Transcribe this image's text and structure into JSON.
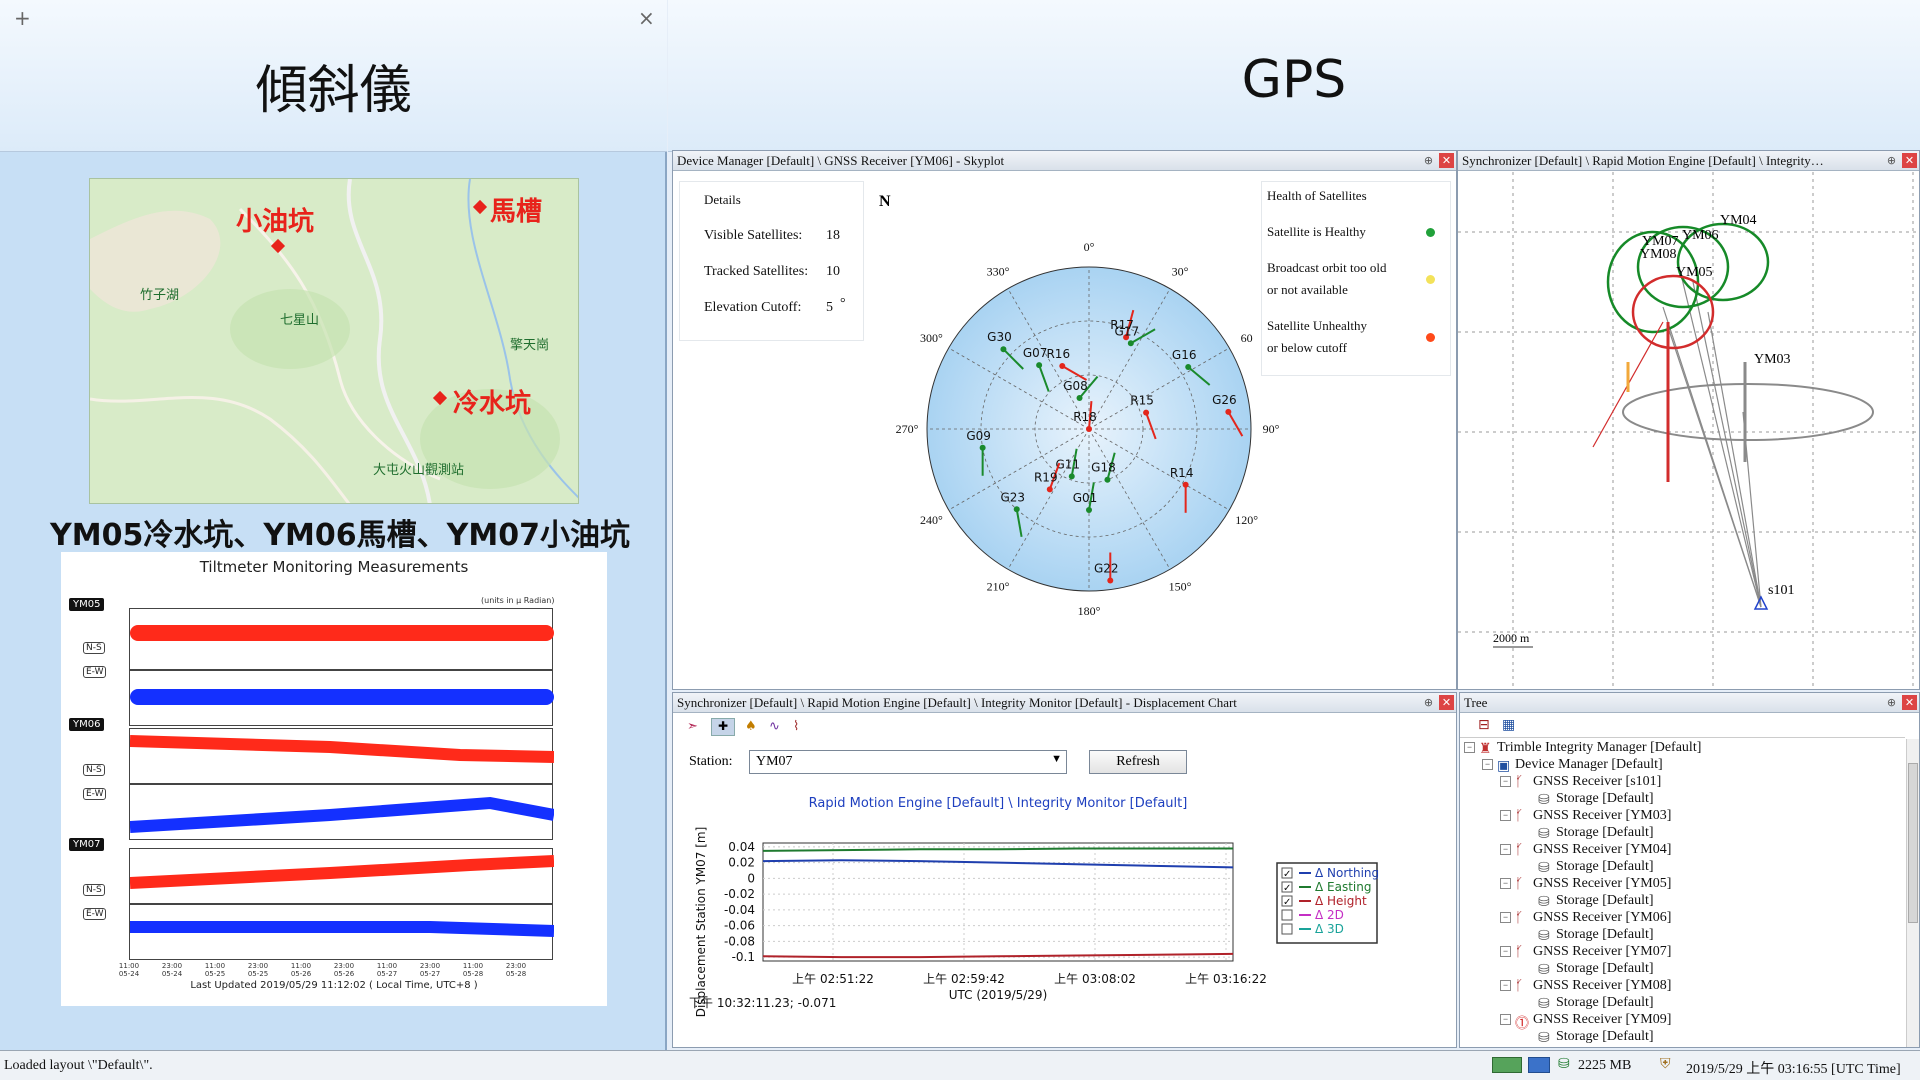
{
  "left": {
    "title": "傾斜儀",
    "new_tab": "+",
    "close": "×",
    "map": {
      "labels_big": [
        "小油坑",
        "馬槽",
        "冷水坑"
      ],
      "labels_small": [
        "竹子湖",
        "七星山",
        "擎天崗",
        "大屯火山觀測站"
      ]
    },
    "stations_caption": "YM05冷水坑、YM06馬槽、YM07小油坑",
    "tiltmeter": {
      "title": "Tiltmeter Monitoring Measurements",
      "units": "(units in μ Radian)",
      "stations": [
        "YM05",
        "YM06",
        "YM07"
      ],
      "axis_ns": "N-S",
      "axis_ew": "E-W",
      "dates": [
        "11:00\n05-24",
        "23:00\n05-24",
        "11:00\n05-25",
        "23:00\n05-25",
        "11:00\n05-26",
        "23:00\n05-26",
        "11:00\n05-27",
        "23:00\n05-27",
        "11:00\n05-28",
        "23:00\n05-28"
      ],
      "updated": "Last Updated 2019/05/29 11:12:02 ( Local Time, UTC+8 )",
      "colors": {
        "ns": "#ff2a1a",
        "ew": "#1430ff"
      }
    }
  },
  "gps": {
    "title": "GPS",
    "skyplot": {
      "title": "Device Manager [Default] \\ GNSS Receiver [YM06] - Skyplot",
      "details_label": "Details",
      "visible_label": "Visible Satellites:",
      "visible_value": "18",
      "tracked_label": "Tracked Satellites:",
      "tracked_value": "10",
      "cutoff_label": "Elevation Cutoff:",
      "cutoff_value": "5",
      "cutoff_unit": "°",
      "health_label": "Health of Satellites",
      "healthy": "Satellite is Healthy",
      "broadcast_1": "Broadcast orbit too old",
      "broadcast_2": "or not available",
      "unhealthy_1": "Satellite Unhealthy",
      "unhealthy_2": "or below cutoff",
      "north_symbol": "N",
      "azimuths": [
        "0°",
        "30°",
        "60",
        "90°",
        "120°",
        "150°",
        "180°",
        "210°",
        "240°",
        "270°",
        "300°",
        "330°"
      ],
      "satellites": [
        {
          "id": "G30",
          "az": 313,
          "el": 25,
          "color": "green",
          "dir": 135
        },
        {
          "id": "R16",
          "az": 337,
          "el": 52,
          "color": "red",
          "dir": 120
        },
        {
          "id": "R17",
          "az": 22,
          "el": 35,
          "color": "red",
          "dir": 15
        },
        {
          "id": "G17",
          "az": 26,
          "el": 37,
          "color": "green",
          "dir": 60
        },
        {
          "id": "G07",
          "az": 322,
          "el": 45,
          "color": "green",
          "dir": 160
        },
        {
          "id": "G08",
          "az": 343,
          "el": 72,
          "color": "green",
          "dir": 40
        },
        {
          "id": "G16",
          "az": 58,
          "el": 25,
          "color": "green",
          "dir": 130
        },
        {
          "id": "R15",
          "az": 74,
          "el": 57,
          "color": "red",
          "dir": 160
        },
        {
          "id": "G26",
          "az": 83,
          "el": 12,
          "color": "red",
          "dir": 150
        },
        {
          "id": "R18",
          "az": 0,
          "el": 90,
          "color": "red",
          "dir": 5
        },
        {
          "id": "G09",
          "az": 260,
          "el": 30,
          "color": "green",
          "dir": 180
        },
        {
          "id": "G11",
          "az": 200,
          "el": 62,
          "color": "green",
          "dir": 10
        },
        {
          "id": "G18",
          "az": 160,
          "el": 60,
          "color": "green",
          "dir": 15
        },
        {
          "id": "R14",
          "az": 120,
          "el": 28,
          "color": "red",
          "dir": 180
        },
        {
          "id": "R19",
          "az": 213,
          "el": 50,
          "color": "red",
          "dir": 20
        },
        {
          "id": "G23",
          "az": 222,
          "el": 30,
          "color": "green",
          "dir": 170
        },
        {
          "id": "G01",
          "az": 180,
          "el": 45,
          "color": "green",
          "dir": 10
        },
        {
          "id": "G22",
          "az": 172,
          "el": 5,
          "color": "red",
          "dir": 0
        }
      ]
    },
    "synchronizer": {
      "title": "Synchronizer [Default] \\ Rapid Motion Engine [Default] \\ Integrity…",
      "labels": [
        "YM04",
        "YM06",
        "YM07",
        "YM08",
        "YM05",
        "YM03",
        "s101"
      ],
      "scale": "2000 m"
    },
    "displacement": {
      "title": "Synchronizer [Default] \\ Rapid Motion Engine [Default] \\ Integrity Monitor [Default] - Displacement Chart",
      "station_label": "Station:",
      "station_value": "YM07",
      "refresh": "Refresh",
      "chart_title": "Rapid Motion Engine [Default] \\ Integrity Monitor [Default]",
      "cursor_readout": "下午 10:32:11.23; -0.071"
    },
    "tree": {
      "title": "Tree",
      "root": "Trimble Integrity Manager [Default]",
      "device_manager": "Device Manager [Default]",
      "receivers": [
        {
          "name": "GNSS Receiver [s101]",
          "storage": "Storage [Default]",
          "warn": false
        },
        {
          "name": "GNSS Receiver [YM03]",
          "storage": "Storage [Default]",
          "warn": false
        },
        {
          "name": "GNSS Receiver [YM04]",
          "storage": "Storage [Default]",
          "warn": false
        },
        {
          "name": "GNSS Receiver [YM05]",
          "storage": "Storage [Default]",
          "warn": false
        },
        {
          "name": "GNSS Receiver [YM06]",
          "storage": "Storage [Default]",
          "warn": false
        },
        {
          "name": "GNSS Receiver [YM07]",
          "storage": "Storage [Default]",
          "warn": false
        },
        {
          "name": "GNSS Receiver [YM08]",
          "storage": "Storage [Default]",
          "warn": false
        },
        {
          "name": "GNSS Receiver [YM09]",
          "storage": "Storage [Default]",
          "warn": true
        }
      ]
    }
  },
  "status": {
    "left": "Loaded layout \\\"Default\\\".",
    "memory": "2225 MB",
    "time": "2019/5/29 上午 03:16:55 [UTC Time]"
  },
  "chart_data": {
    "type": "line",
    "title": "Rapid Motion Engine [Default] \\ Integrity Monitor [Default]",
    "xlabel": "UTC (2019/5/29)",
    "ylabel": "Displacement Station YM07 [m]",
    "x_ticks": [
      "上午 02:51:22",
      "上午 02:59:42",
      "上午 03:08:02",
      "上午 03:16:22"
    ],
    "y_ticks": [
      "0.04",
      "0.02",
      "0",
      "-0.02",
      "-0.04",
      "-0.06",
      "-0.08",
      "-0.1"
    ],
    "ylim": [
      -0.105,
      0.045
    ],
    "grid": true,
    "legend_position": "right",
    "x": [
      "02:45",
      "02:51",
      "02:57",
      "03:03",
      "03:09",
      "03:15",
      "03:20"
    ],
    "series": [
      {
        "name": "Δ Northing",
        "checked": true,
        "color": "#1f3fae",
        "values": [
          0.022,
          0.023,
          0.022,
          0.02,
          0.018,
          0.016,
          0.014
        ]
      },
      {
        "name": "Δ Easting",
        "checked": true,
        "color": "#1f7a2f",
        "values": [
          0.035,
          0.036,
          0.037,
          0.037,
          0.038,
          0.038,
          0.038
        ]
      },
      {
        "name": "Δ Height",
        "checked": true,
        "color": "#b0222a",
        "values": [
          -0.099,
          -0.1,
          -0.1,
          -0.099,
          -0.098,
          -0.097,
          -0.096
        ]
      },
      {
        "name": "Δ 2D",
        "checked": false,
        "color": "#c42fc4",
        "values": []
      },
      {
        "name": "Δ 3D",
        "checked": false,
        "color": "#1aa39a",
        "values": []
      }
    ]
  }
}
